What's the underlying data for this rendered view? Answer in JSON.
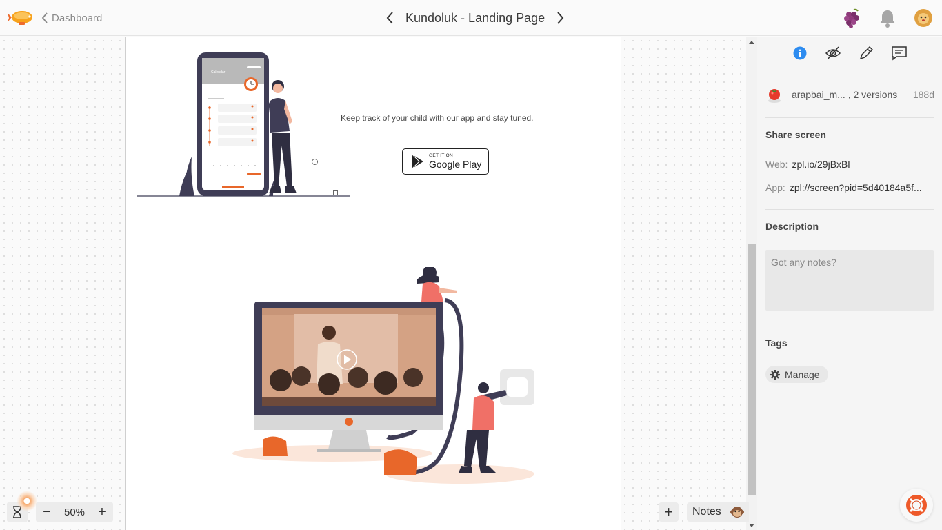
{
  "topbar": {
    "back_label": "Dashboard",
    "screen_title": "Kundoluk - Landing Page",
    "icons": [
      "zeppelin-logo-icon",
      "chevron-left-icon",
      "chevron-right-icon",
      "grapes-icon",
      "bell-icon",
      "lion-avatar-icon"
    ]
  },
  "artboard": {
    "tagline": "Keep track of your child with our app and stay tuned.",
    "store_badge": {
      "small": "GET IT ON",
      "big": "Google Play"
    },
    "phone_screen_title": "Calendar"
  },
  "zoom": {
    "minus": "−",
    "value": "50%",
    "plus": "+"
  },
  "canvas_controls": {
    "add": "+",
    "notes_label": "Notes"
  },
  "sidebar": {
    "tabs": [
      "info-icon",
      "no-eye-icon",
      "pencil-icon",
      "comment-icon"
    ],
    "active_tab": "info-icon",
    "owner": "arapbai_m... , 2 versions",
    "age": "188d",
    "share_title": "Share screen",
    "web_label": "Web:",
    "web_value": "zpl.io/29jBxBl",
    "app_label": "App:",
    "app_value": "zpl://screen?pid=5d40184a5f...",
    "description_title": "Description",
    "description_placeholder": "Got any notes?",
    "tags_title": "Tags",
    "manage_label": "Manage"
  },
  "colors": {
    "accent_blue": "#2d8cf0",
    "illustration_orange": "#e8672a",
    "illustration_dark": "#3f3d56"
  }
}
